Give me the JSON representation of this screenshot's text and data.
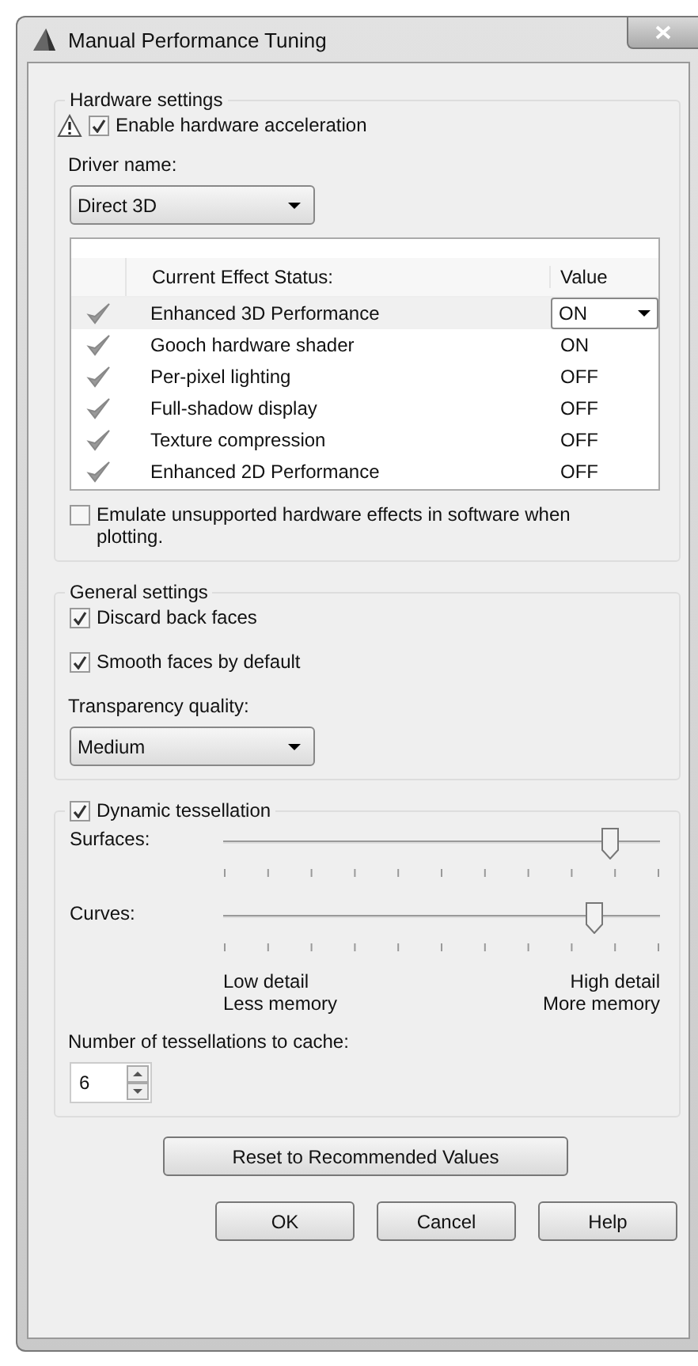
{
  "window": {
    "title": "Manual Performance Tuning"
  },
  "hardware": {
    "title": "Hardware settings",
    "acceleration": {
      "label": "Enable hardware acceleration",
      "checked": true
    },
    "driver_label": "Driver name:",
    "driver": "Direct 3D",
    "table": {
      "columns": [
        "Current Effect Status:",
        "Value"
      ],
      "rows": [
        {
          "name": "Enhanced 3D Performance",
          "value": "ON",
          "selected": true
        },
        {
          "name": "Gooch hardware shader",
          "value": "ON",
          "selected": false
        },
        {
          "name": "Per-pixel lighting",
          "value": "OFF",
          "selected": false
        },
        {
          "name": "Full-shadow display",
          "value": "OFF",
          "selected": false
        },
        {
          "name": "Texture compression",
          "value": "OFF",
          "selected": false
        },
        {
          "name": "Enhanced 2D Performance",
          "value": "OFF",
          "selected": false
        }
      ]
    },
    "emulate": {
      "label": "Emulate unsupported hardware effects in software when plotting.",
      "checked": false
    }
  },
  "general": {
    "title": "General settings",
    "checks": [
      {
        "label": "Discard back faces",
        "checked": true
      },
      {
        "label": "Smooth faces by default",
        "checked": true
      }
    ],
    "transparency_label": "Transparency quality:",
    "transparency": "Medium"
  },
  "tessellation": {
    "title": "Dynamic tessellation",
    "checked": true,
    "sliders": [
      {
        "label": "Surfaces:",
        "level": 0.9
      },
      {
        "label": "Curves:",
        "level": 0.86
      }
    ],
    "low": [
      "Low detail",
      "Less memory"
    ],
    "high": [
      "High detail",
      "More memory"
    ],
    "cache_label": "Number of tessellations to cache:",
    "cache": "6"
  },
  "reset_button": "Reset to Recommended Values",
  "buttons": [
    "OK",
    "Cancel",
    "Help"
  ]
}
